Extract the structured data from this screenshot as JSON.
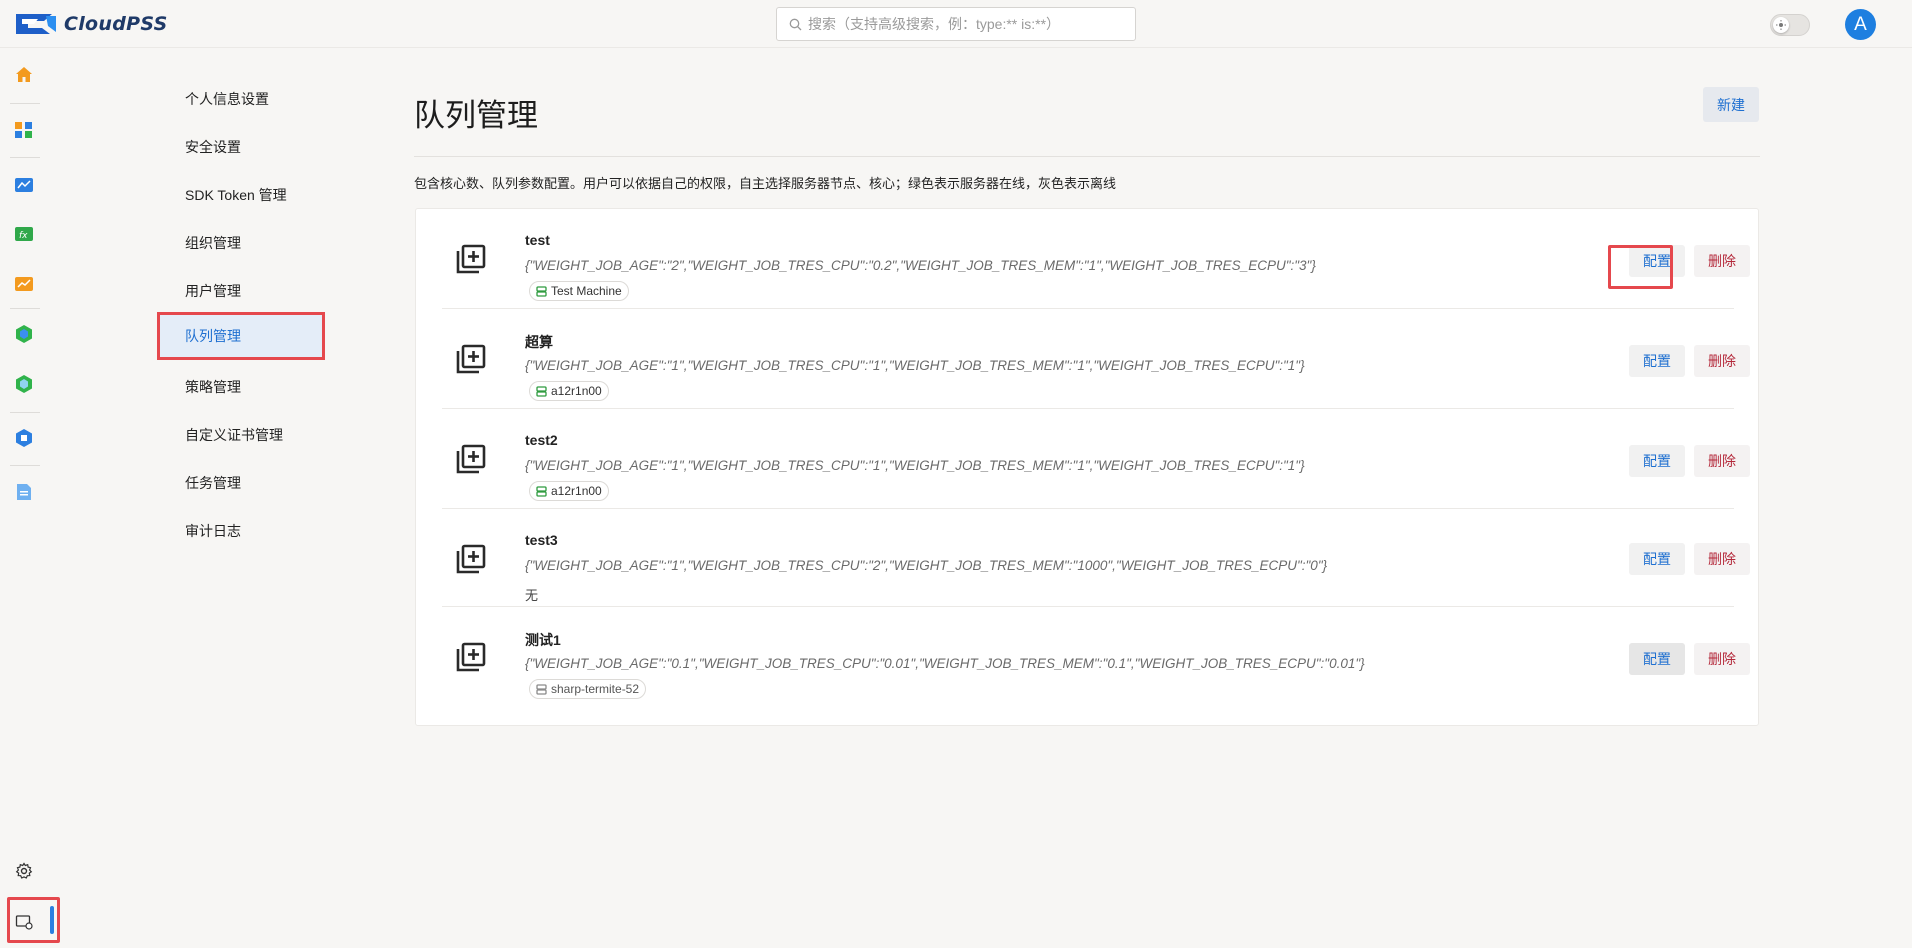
{
  "app": {
    "logo_text": "CloudPSS"
  },
  "search": {
    "placeholder": "搜索（支持高级搜索，例：type:** is:**）"
  },
  "user": {
    "avatar_initial": "A"
  },
  "rail": {
    "icons": [
      "home-icon",
      "apps-icon",
      "simulation-icon",
      "function-icon",
      "chart-icon",
      "model-icon",
      "component-icon",
      "package-icon",
      "document-icon",
      "gear-icon",
      "terminal-settings-icon"
    ]
  },
  "menu": {
    "items": [
      {
        "label": "个人信息设置"
      },
      {
        "label": "安全设置"
      },
      {
        "label": "SDK Token 管理"
      },
      {
        "label": "组织管理"
      },
      {
        "label": "用户管理"
      },
      {
        "label": "队列管理",
        "active": true
      },
      {
        "label": "策略管理"
      },
      {
        "label": "自定义证书管理"
      },
      {
        "label": "任务管理"
      },
      {
        "label": "审计日志"
      }
    ]
  },
  "main": {
    "title": "队列管理",
    "new_label": "新建",
    "description": "包含核心数、队列参数配置。用户可以依据自己的权限，自主选择服务器节点、核心；绿色表示服务器在线，灰色表示离线"
  },
  "queues": [
    {
      "name": "test",
      "params": "{\"WEIGHT_JOB_AGE\":\"2\",\"WEIGHT_JOB_TRES_CPU\":\"0.2\",\"WEIGHT_JOB_TRES_MEM\":\"1\",\"WEIGHT_JOB_TRES_ECPU\":\"3\"}",
      "node": "Test Machine",
      "node_status": "online",
      "config_label": "配置",
      "delete_label": "删除"
    },
    {
      "name": "超算",
      "params": "{\"WEIGHT_JOB_AGE\":\"1\",\"WEIGHT_JOB_TRES_CPU\":\"1\",\"WEIGHT_JOB_TRES_MEM\":\"1\",\"WEIGHT_JOB_TRES_ECPU\":\"1\"}",
      "node": "a12r1n00",
      "node_status": "online",
      "config_label": "配置",
      "delete_label": "删除"
    },
    {
      "name": "test2",
      "params": "{\"WEIGHT_JOB_AGE\":\"1\",\"WEIGHT_JOB_TRES_CPU\":\"1\",\"WEIGHT_JOB_TRES_MEM\":\"1\",\"WEIGHT_JOB_TRES_ECPU\":\"1\"}",
      "node": "a12r1n00",
      "node_status": "online",
      "config_label": "配置",
      "delete_label": "删除"
    },
    {
      "name": "test3",
      "params": "{\"WEIGHT_JOB_AGE\":\"1\",\"WEIGHT_JOB_TRES_CPU\":\"2\",\"WEIGHT_JOB_TRES_MEM\":\"1000\",\"WEIGHT_JOB_TRES_ECPU\":\"0\"}",
      "node": "无",
      "node_status": "none",
      "config_label": "配置",
      "delete_label": "删除"
    },
    {
      "name": "测试1",
      "params": "{\"WEIGHT_JOB_AGE\":\"0.1\",\"WEIGHT_JOB_TRES_CPU\":\"0.01\",\"WEIGHT_JOB_TRES_MEM\":\"0.1\",\"WEIGHT_JOB_TRES_ECPU\":\"0.01\"}",
      "node": "sharp-termite-52",
      "node_status": "offline",
      "config_label": "配置",
      "delete_label": "删除"
    }
  ],
  "colors": {
    "accent": "#1e6fd0",
    "danger": "#b4283a",
    "online": "#2e9b3f",
    "offline": "#8a8a8a",
    "highlight": "#e5484d"
  }
}
